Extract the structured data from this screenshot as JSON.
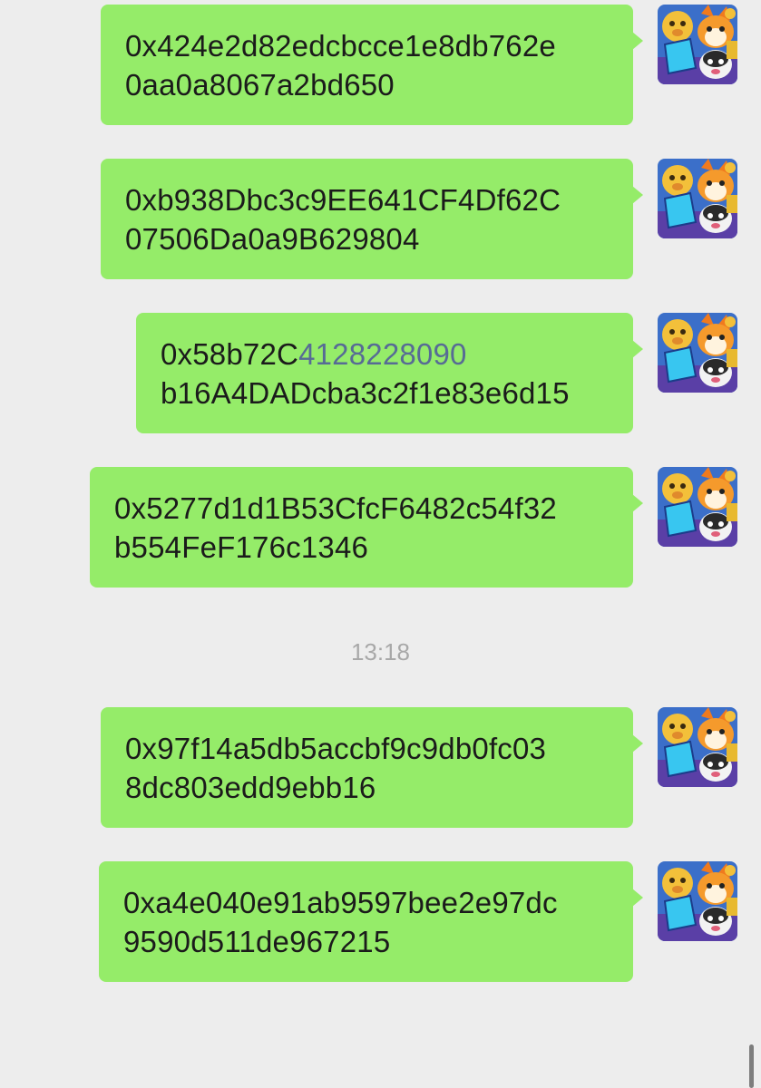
{
  "chat": {
    "messages": [
      {
        "line1": "0x424e2d82edcbcce1e8db762e",
        "line2": "0aa0a8067a2bd650"
      },
      {
        "line1": "0xb938Dbc3c9EE641CF4Df62C",
        "line2": "07506Da0a9B629804"
      },
      {
        "line1_prefix": "0x58b72C",
        "line1_link": "4128228090",
        "line2": "b16A4DADcba3c2f1e83e6d15"
      },
      {
        "line1": "0x5277d1d1B53CfcF6482c54f32",
        "line2": "b554FeF176c1346"
      },
      {
        "line1": "0x97f14a5db5accbf9c9db0fc03",
        "line2": "8dc803edd9ebb16"
      },
      {
        "line1": "0xa4e040e91ab9597bee2e97dc",
        "line2": "9590d511de967215"
      }
    ],
    "timestamp": "13:18"
  },
  "theme": {
    "bubble_color": "#95ec69",
    "background": "#ededed",
    "link_color": "#576b95"
  },
  "avatar_icon": "cartoon-dogs-avatar-icon"
}
